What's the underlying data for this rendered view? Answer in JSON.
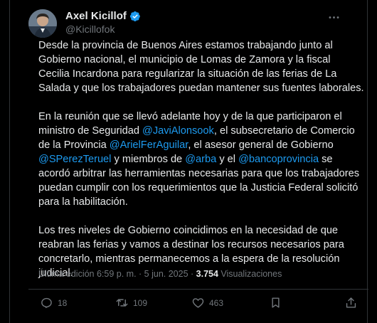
{
  "author": {
    "name": "Axel Kicillof",
    "handle": "@Kicillofok"
  },
  "paragraphs": {
    "p1": "Desde la provincia de Buenos Aires estamos trabajando junto al Gobierno nacional, el municipio de Lomas de Zamora y la fiscal Cecilia Incardona para regularizar la situación de las ferias de La Salada y que los trabajadores puedan mantener sus fuentes laborales.",
    "p2": {
      "t1": "En la reunión que se llevó adelante hoy y de la que participaron el ministro de Seguridad ",
      "m1": "@JaviAlonsook",
      "t2": ", el subsecretario de Comercio de la Provincia ",
      "m2": "@ArielFerAguilar",
      "t3": ", el asesor general de Gobierno ",
      "m3": "@SPerezTeruel",
      "t4": " y miembros de ",
      "m4": "@arba",
      "t5": " y el ",
      "m5": "@bancoprovincia",
      "t6": " se acordó arbitrar las herramientas necesarias para que los trabajadores puedan cumplir con los requerimientos que la Justicia Federal solicitó para la habilitación."
    },
    "p3": "Los tres niveles de Gobierno coincidimos en la necesidad de que reabran las ferias y vamos a destinar los recursos necesarios para concretarlo, mientras permanecemos a la espera de la resolución judicial."
  },
  "meta": {
    "edited": "Última edición 6:59 p. m. · 5 jun. 2025 · ",
    "views_count": "3.754",
    "views_label": " Visualizaciones"
  },
  "actions": {
    "replies": "18",
    "reposts": "109",
    "likes": "463"
  },
  "icons": [
    "verified-badge-icon",
    "more-options-icon",
    "reply-icon",
    "repost-icon",
    "like-icon",
    "bookmark-icon"
  ],
  "colors": {
    "accent": "#1d9bf0",
    "muted": "#71767b",
    "text": "#e7e9ea",
    "background": "#000000"
  }
}
